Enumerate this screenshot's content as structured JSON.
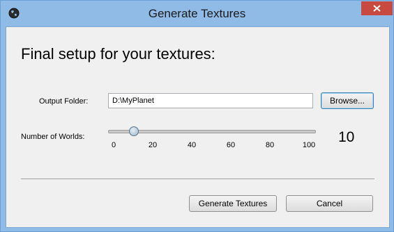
{
  "window": {
    "title": "Generate Textures",
    "app_icon": "globe-icon",
    "close_icon": "close-icon"
  },
  "heading": "Final setup for your textures:",
  "output": {
    "label": "Output Folder:",
    "value": "D:\\MyPlanet",
    "browse_label": "Browse..."
  },
  "worlds": {
    "label": "Number of Worlds:",
    "value": 10,
    "display": "10",
    "min": 0,
    "max": 100,
    "ticks": [
      "0",
      "20",
      "40",
      "60",
      "80",
      "100"
    ]
  },
  "buttons": {
    "generate": "Generate Textures",
    "cancel": "Cancel"
  },
  "colors": {
    "titlebar": "#8fbbe6",
    "close": "#c7493f",
    "client": "#f0f0f0"
  }
}
